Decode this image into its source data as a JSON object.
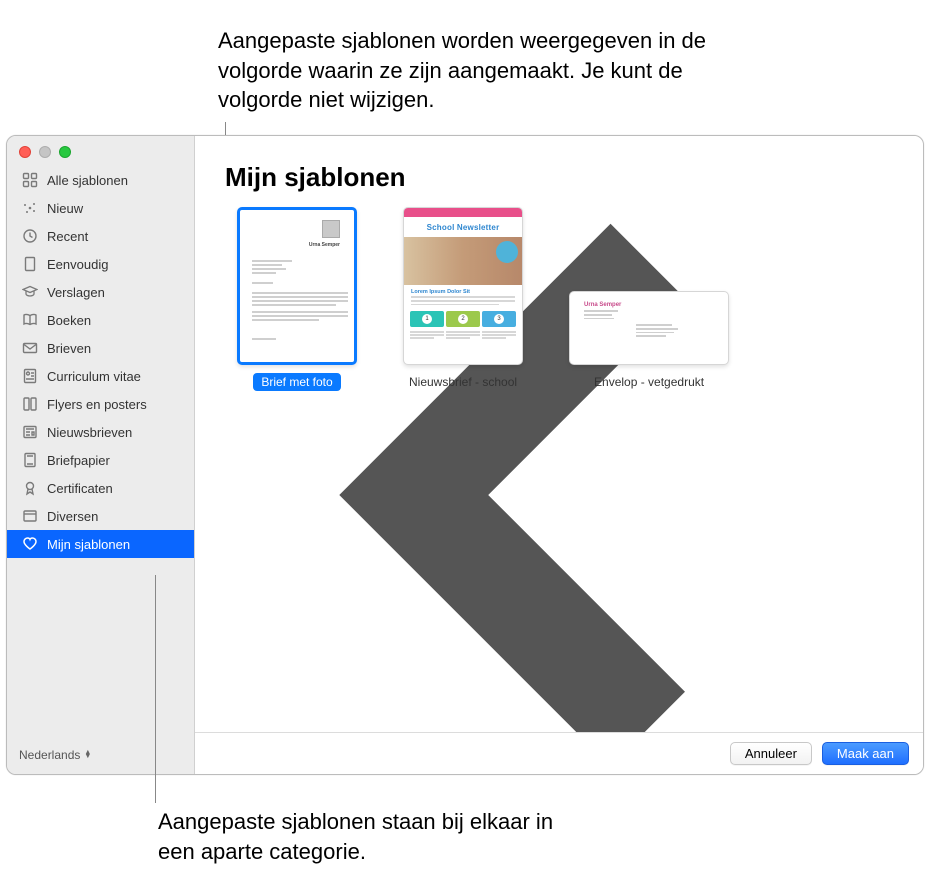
{
  "callouts": {
    "top": "Aangepaste sjablonen worden weergegeven in de volgorde waarin ze zijn aangemaakt. Je kunt de volgorde niet wijzigen.",
    "bottom": "Aangepaste sjablonen staan bij elkaar in een aparte categorie."
  },
  "sidebar": {
    "items": [
      {
        "label": "Alle sjablonen",
        "icon": "grid-icon"
      },
      {
        "label": "Nieuw",
        "icon": "sparkle-icon"
      },
      {
        "label": "Recent",
        "icon": "clock-icon"
      },
      {
        "label": "Eenvoudig",
        "icon": "page-icon"
      },
      {
        "label": "Verslagen",
        "icon": "graduation-icon"
      },
      {
        "label": "Boeken",
        "icon": "book-icon"
      },
      {
        "label": "Brieven",
        "icon": "envelope-icon"
      },
      {
        "label": "Curriculum vitae",
        "icon": "profile-icon"
      },
      {
        "label": "Flyers en posters",
        "icon": "columns-icon"
      },
      {
        "label": "Nieuwsbrieven",
        "icon": "newspaper-icon"
      },
      {
        "label": "Briefpapier",
        "icon": "letterhead-icon"
      },
      {
        "label": "Certificaten",
        "icon": "ribbon-icon"
      },
      {
        "label": "Diversen",
        "icon": "folder-icon"
      },
      {
        "label": "Mijn sjablonen",
        "icon": "heart-icon"
      }
    ],
    "selected_index": 13
  },
  "language": "Nederlands",
  "main": {
    "title": "Mijn sjablonen",
    "templates": [
      {
        "label": "Brief met foto",
        "selected": true,
        "kind": "letter"
      },
      {
        "label": "Nieuwsbrief - school",
        "selected": false,
        "kind": "newsletter"
      },
      {
        "label": "Envelop - vetgedrukt",
        "selected": false,
        "kind": "envelope"
      }
    ],
    "newsletter_preview": {
      "heading": "School Newsletter",
      "lorem": "Lorem Ipsum Dolor Sit"
    },
    "envelope_preview": {
      "sender": "Urna Semper"
    }
  },
  "footer": {
    "cancel": "Annuleer",
    "create": "Maak aan"
  }
}
